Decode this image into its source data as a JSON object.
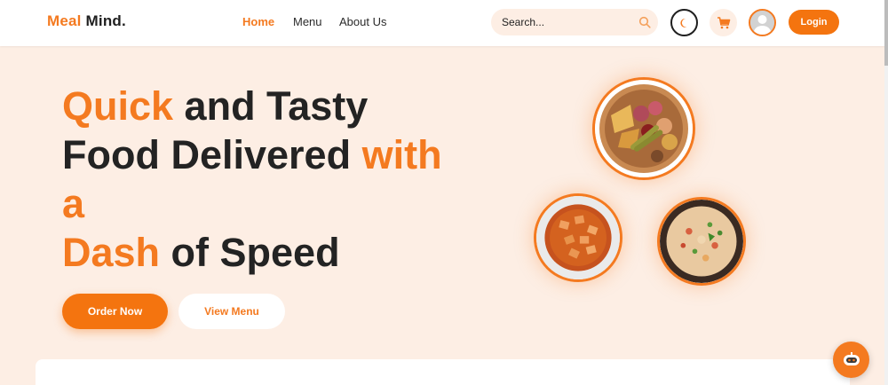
{
  "brand": {
    "part1": "Meal",
    "part2": "Mind."
  },
  "nav": {
    "links": [
      {
        "label": "Home",
        "active": true
      },
      {
        "label": "Menu",
        "active": false
      },
      {
        "label": "About Us",
        "active": false
      }
    ]
  },
  "search": {
    "placeholder": "Search...",
    "icon": "search-icon"
  },
  "header_actions": {
    "theme_icon": "moon-icon",
    "cart_icon": "cart-icon",
    "avatar_icon": "user-avatar",
    "login_label": "Login"
  },
  "hero": {
    "line1_hl": "Quick",
    "line1_rest": " and Tasty",
    "line2_a": "Food Delivered ",
    "line2_hl": "with",
    "line3_hl": "a",
    "line4_hl": "Dash",
    "line4_rest": " of Speed",
    "order_label": "Order Now",
    "view_label": "View Menu"
  },
  "dishes": [
    {
      "name": "platter-dish"
    },
    {
      "name": "curry-dish"
    },
    {
      "name": "rice-dish"
    }
  ],
  "chat": {
    "icon": "chatbot-icon"
  },
  "colors": {
    "accent": "#f47a20",
    "hero_bg": "#fdeee4",
    "text_dark": "#232323"
  }
}
